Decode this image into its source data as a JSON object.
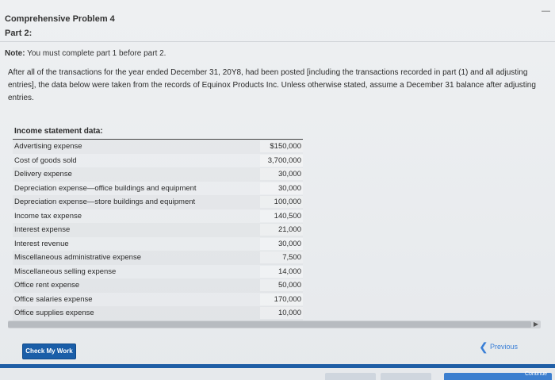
{
  "header": {
    "title": "Comprehensive Problem 4",
    "part": "Part 2:",
    "corner_mark": "—"
  },
  "note": {
    "label": "Note:",
    "text": "You must complete part 1 before part 2."
  },
  "paragraph": {
    "text": "After all of the transactions for the year ended December 31, 20Y8, had been posted [including the transactions recorded in part (1) and all adjusting entries], the data below were taken from the records of Equinox Products Inc. Unless otherwise stated, assume a December 31 balance after adjusting entries."
  },
  "table": {
    "title": "Income statement data:",
    "rows": [
      {
        "label": "Advertising expense",
        "amount": "$150,000"
      },
      {
        "label": "Cost of goods sold",
        "amount": "3,700,000"
      },
      {
        "label": "Delivery expense",
        "amount": "30,000"
      },
      {
        "label": "Depreciation expense—office buildings and equipment",
        "amount": "30,000"
      },
      {
        "label": "Depreciation expense—store buildings and equipment",
        "amount": "100,000"
      },
      {
        "label": "Income tax expense",
        "amount": "140,500"
      },
      {
        "label": "Interest expense",
        "amount": "21,000"
      },
      {
        "label": "Interest revenue",
        "amount": "30,000"
      },
      {
        "label": "Miscellaneous administrative expense",
        "amount": "7,500"
      },
      {
        "label": "Miscellaneous selling expense",
        "amount": "14,000"
      },
      {
        "label": "Office rent expense",
        "amount": "50,000"
      },
      {
        "label": "Office salaries expense",
        "amount": "170,000"
      },
      {
        "label": "Office supplies expense",
        "amount": "10,000"
      }
    ]
  },
  "buttons": {
    "check": "Check My Work",
    "previous": "Previous"
  },
  "bottom_tabs": {
    "third_label": "Continue"
  },
  "colors": {
    "accent": "#1a5ea8",
    "link": "#3a7fd6"
  }
}
